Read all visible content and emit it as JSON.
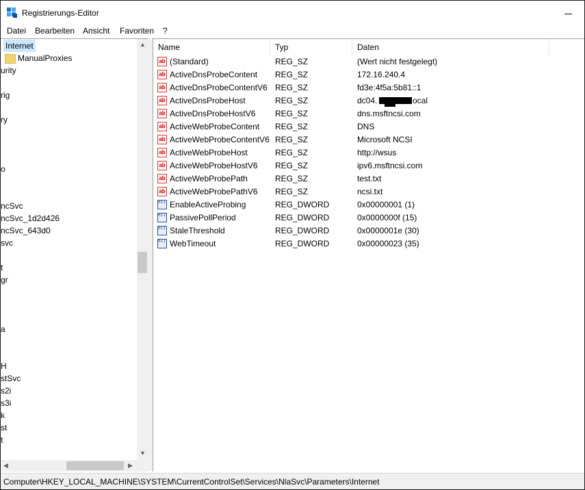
{
  "window": {
    "title": "Registrierungs-Editor"
  },
  "menu": [
    "Datei",
    "Bearbeiten",
    "Ansicht",
    "Favoriten",
    "?"
  ],
  "tree": {
    "selected": "Internet",
    "child": "ManualProxies",
    "partial_items": [
      "urity",
      "rig",
      "ry",
      "o",
      "ncSvc",
      "ncSvc_1d2d426",
      "ncSvc_643d0",
      "svc",
      "t",
      "gr",
      "a",
      "H",
      "stSvc",
      "s2i",
      "s3i",
      "k",
      "st",
      "t"
    ]
  },
  "columns": {
    "name": "Name",
    "type": "Typ",
    "data": "Daten"
  },
  "values": [
    {
      "name": "(Standard)",
      "type": "REG_SZ",
      "data": "(Wert nicht festgelegt)",
      "icon": "string-value-icon"
    },
    {
      "name": "ActiveDnsProbeContent",
      "type": "REG_SZ",
      "data": "172.16.240.4",
      "icon": "string-value-icon"
    },
    {
      "name": "ActiveDnsProbeContentV6",
      "type": "REG_SZ",
      "data": "fd3e:4f5a:5b81::1",
      "icon": "string-value-icon"
    },
    {
      "name": "ActiveDnsProbeHost",
      "type": "REG_SZ",
      "data": "dc04.",
      "data_suffix": "ocal",
      "redacted": true,
      "icon": "string-value-icon"
    },
    {
      "name": "ActiveDnsProbeHostV6",
      "type": "REG_SZ",
      "data": "dns.msftncsi.com",
      "icon": "string-value-icon"
    },
    {
      "name": "ActiveWebProbeContent",
      "type": "REG_SZ",
      "data": "DNS",
      "icon": "string-value-icon"
    },
    {
      "name": "ActiveWebProbeContentV6",
      "type": "REG_SZ",
      "data": "Microsoft NCSI",
      "icon": "string-value-icon"
    },
    {
      "name": "ActiveWebProbeHost",
      "type": "REG_SZ",
      "data": "http://wsus",
      "icon": "string-value-icon"
    },
    {
      "name": "ActiveWebProbeHostV6",
      "type": "REG_SZ",
      "data": "ipv6.msftncsi.com",
      "icon": "string-value-icon"
    },
    {
      "name": "ActiveWebProbePath",
      "type": "REG_SZ",
      "data": "test.txt",
      "icon": "string-value-icon"
    },
    {
      "name": "ActiveWebProbePathV6",
      "type": "REG_SZ",
      "data": "ncsi.txt",
      "icon": "string-value-icon"
    },
    {
      "name": "EnableActiveProbing",
      "type": "REG_DWORD",
      "data": "0x00000001 (1)",
      "icon": "binary-value-icon"
    },
    {
      "name": "PassivePollPeriod",
      "type": "REG_DWORD",
      "data": "0x0000000f (15)",
      "icon": "binary-value-icon"
    },
    {
      "name": "StaleThreshold",
      "type": "REG_DWORD",
      "data": "0x0000001e (30)",
      "icon": "binary-value-icon"
    },
    {
      "name": "WebTimeout",
      "type": "REG_DWORD",
      "data": "0x00000023 (35)",
      "icon": "binary-value-icon"
    }
  ],
  "status": {
    "path": "Computer\\HKEY_LOCAL_MACHINE\\SYSTEM\\CurrentControlSet\\Services\\NlaSvc\\Parameters\\Internet"
  },
  "icons": {
    "sz_glyph": "ab",
    "dword_glyph": "011 110"
  },
  "colors": {
    "selection": "#cce8ff",
    "folder": "#f3d271"
  }
}
